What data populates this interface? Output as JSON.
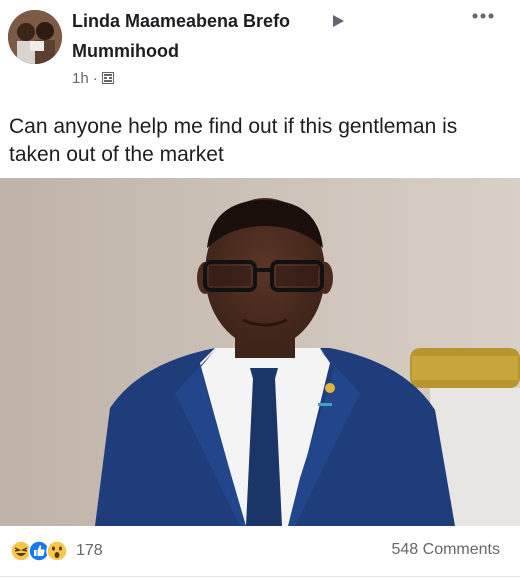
{
  "post": {
    "author": "Linda Maameabena Brefo",
    "group": "Mummihood",
    "time": "1h",
    "separator": "·",
    "text": "Can anyone help me find out if this gentleman is taken out of the market",
    "icons": {
      "arrow": "right-triangle-icon",
      "privacy": "group-privacy-icon",
      "more": "more-options-icon"
    }
  },
  "engagement": {
    "reaction_icons": [
      "haha-icon",
      "like-icon",
      "wow-icon"
    ],
    "reaction_count": "178",
    "comments": "548 Comments"
  },
  "colors": {
    "suit": "#1f3d7a",
    "like_blue": "#1877f2",
    "reaction_yellow": "#f7c64a"
  }
}
